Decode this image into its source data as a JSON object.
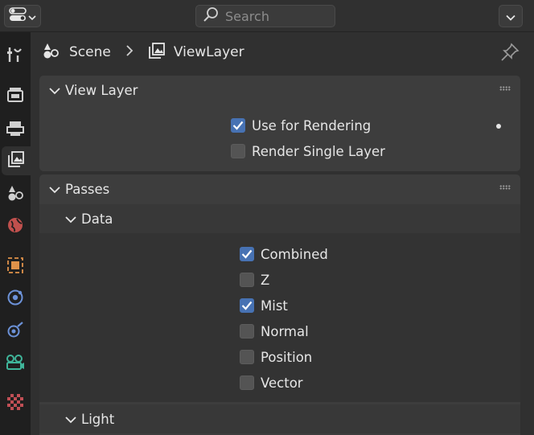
{
  "header": {
    "search_placeholder": "Search"
  },
  "breadcrumb": {
    "scene": "Scene",
    "view_layer": "ViewLayer"
  },
  "view_layer_panel": {
    "title": "View Layer",
    "use_for_rendering": {
      "label": "Use for Rendering",
      "checked": true
    },
    "render_single_layer": {
      "label": "Render Single Layer",
      "checked": false
    }
  },
  "passes_panel": {
    "title": "Passes",
    "data_section": {
      "title": "Data",
      "items": [
        {
          "label": "Combined",
          "checked": true
        },
        {
          "label": "Z",
          "checked": false
        },
        {
          "label": "Mist",
          "checked": true
        },
        {
          "label": "Normal",
          "checked": false
        },
        {
          "label": "Position",
          "checked": false
        },
        {
          "label": "Vector",
          "checked": false
        }
      ]
    },
    "light_section": {
      "title": "Light"
    }
  },
  "tabs": [
    "tool-icon",
    "render-icon",
    "output-icon",
    "view-layer-icon",
    "scene-icon",
    "world-icon",
    "object-icon",
    "modifier-icon",
    "particles-icon",
    "physics-icon",
    "texture-icon"
  ],
  "colors": {
    "accent": "#4772b3",
    "panel": "#3d3d3d",
    "background": "#303030"
  }
}
